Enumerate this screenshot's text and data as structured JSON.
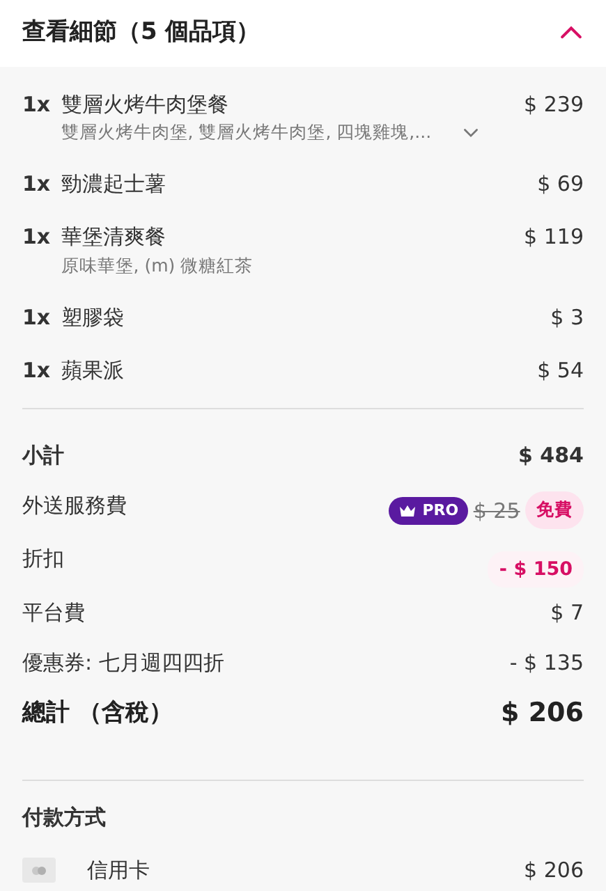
{
  "header": {
    "title": "查看細節（5 個品項）",
    "expanded": true
  },
  "items": [
    {
      "qty": "1x",
      "name": "雙層火烤牛肉堡餐",
      "price": "$ 239",
      "description": "雙層火烤牛肉堡, 雙層火烤牛肉堡, 四塊雞塊,...",
      "expandable": true
    },
    {
      "qty": "1x",
      "name": "勁濃起士薯",
      "price": "$ 69",
      "expandable": false
    },
    {
      "qty": "1x",
      "name": "華堡清爽餐",
      "price": "$ 119",
      "description": "原味華堡, (m) 微糖紅茶",
      "expandable": false
    },
    {
      "qty": "1x",
      "name": "塑膠袋",
      "price": "$ 3",
      "expandable": false
    },
    {
      "qty": "1x",
      "name": "蘋果派",
      "price": "$ 54",
      "expandable": false
    }
  ],
  "summary": [
    {
      "kind": "bold",
      "label": "小計",
      "value": "$ 484"
    },
    {
      "kind": "delivery",
      "label": "外送服務費",
      "badge": "PRO",
      "old_value": "$ 25",
      "value": "免費"
    },
    {
      "kind": "discount",
      "label": "折扣",
      "value": "- $ 150"
    },
    {
      "kind": "plain",
      "label": "平台費",
      "value": "$ 7"
    },
    {
      "kind": "plain",
      "label": "優惠券: 七月週四四折",
      "value": "- $ 135"
    },
    {
      "kind": "total",
      "label": "總計 （含稅）",
      "value": "$ 206"
    }
  ],
  "payment": {
    "heading": "付款方式",
    "method": "信用卡",
    "amount": "$ 206"
  }
}
